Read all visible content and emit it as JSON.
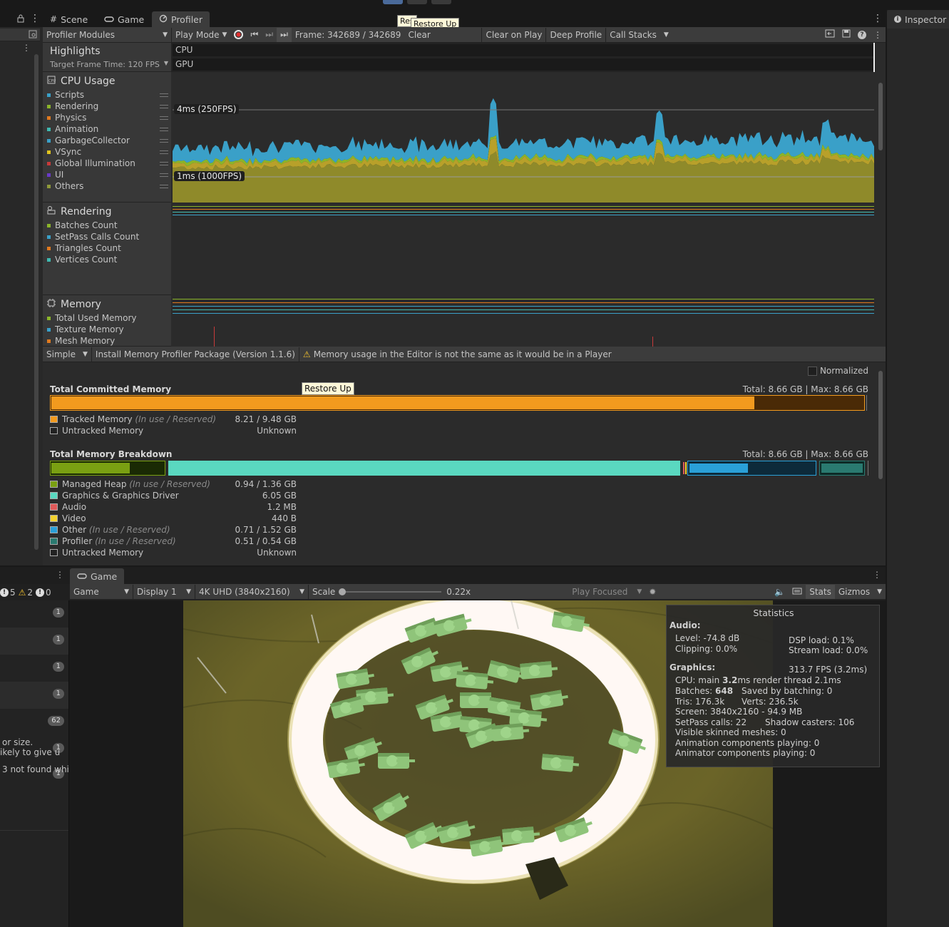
{
  "topbar": {
    "tabs": [
      {
        "label": "Scene"
      },
      {
        "label": "Game"
      },
      {
        "label": "Profiler"
      }
    ],
    "tooltip_partial": "Res",
    "tooltip": "Restore Up",
    "inspector": "Inspector"
  },
  "toolbar": {
    "modules": "Profiler Modules",
    "play_mode": "Play Mode",
    "frame": "Frame: 342689 / 342689",
    "clear": "Clear",
    "clear_on_play": "Clear on Play",
    "deep_profile": "Deep Profile",
    "call_stacks": "Call Stacks"
  },
  "highlights": {
    "title": "Highlights",
    "target": "Target Frame Time: 120 FPS",
    "rows": [
      "CPU",
      "GPU"
    ]
  },
  "cpu_module": {
    "title": "CPU Usage",
    "legend": [
      {
        "label": "Scripts",
        "color": "#3aa0c8"
      },
      {
        "label": "Rendering",
        "color": "#8bb52a"
      },
      {
        "label": "Physics",
        "color": "#e07a1f"
      },
      {
        "label": "Animation",
        "color": "#3fb8b0"
      },
      {
        "label": "GarbageCollector",
        "color": "#3aa0c8"
      },
      {
        "label": "VSync",
        "color": "#e0c41f"
      },
      {
        "label": "Global Illumination",
        "color": "#c83a3a"
      },
      {
        "label": "UI",
        "color": "#6a3ac8"
      },
      {
        "label": "Others",
        "color": "#8f9a3a"
      }
    ],
    "marker_high": "4ms (250FPS)",
    "marker_low": "1ms (1000FPS)"
  },
  "rendering_module": {
    "title": "Rendering",
    "legend": [
      {
        "label": "Batches Count",
        "color": "#8bb52a"
      },
      {
        "label": "SetPass Calls Count",
        "color": "#3aa0c8"
      },
      {
        "label": "Triangles Count",
        "color": "#e07a1f"
      },
      {
        "label": "Vertices Count",
        "color": "#3fb8b0"
      }
    ]
  },
  "memory_module": {
    "title": "Memory",
    "legend": [
      {
        "label": "Total Used Memory",
        "color": "#8bb52a"
      },
      {
        "label": "Texture Memory",
        "color": "#3aa0c8"
      },
      {
        "label": "Mesh Memory",
        "color": "#e07a1f"
      }
    ]
  },
  "memory_toolbar": {
    "mode": "Simple",
    "install": "Install Memory Profiler Package (Version 1.1.6)",
    "warning": "Memory usage in the Editor is not the same as it would be in a Player"
  },
  "memory_detail": {
    "normalized": "Normalized",
    "tooltip": "Restore Up",
    "committed": {
      "title": "Total Committed Memory",
      "total": "Total: 8.66 GB | Max: 8.66 GB",
      "tracked_fraction": 0.866,
      "rows": [
        {
          "label": "Tracked Memory",
          "note": "(In use / Reserved)",
          "value": "8.21 / 9.48 GB",
          "color": "#f29a1e"
        },
        {
          "label": "Untracked Memory",
          "note": "",
          "value": "Unknown",
          "color": "#222222"
        }
      ]
    },
    "breakdown": {
      "title": "Total Memory Breakdown",
      "total": "Total: 8.66 GB | Max: 8.66 GB",
      "rows": [
        {
          "label": "Managed Heap",
          "note": "(In use / Reserved)",
          "value": "0.94 / 1.36 GB",
          "color": "#7aa012"
        },
        {
          "label": "Graphics & Graphics Driver",
          "note": "",
          "value": "6.05 GB",
          "color": "#5ad8c0"
        },
        {
          "label": "Audio",
          "note": "",
          "value": "1.2 MB",
          "color": "#e05a5a"
        },
        {
          "label": "Video",
          "note": "",
          "value": "440 B",
          "color": "#f2d22e"
        },
        {
          "label": "Other",
          "note": "(In use / Reserved)",
          "value": "0.71 / 1.52 GB",
          "color": "#2aa0d8"
        },
        {
          "label": "Profiler",
          "note": "(In use / Reserved)",
          "value": "0.51 / 0.54 GB",
          "color": "#2a7a70"
        },
        {
          "label": "Untracked Memory",
          "note": "",
          "value": "Unknown",
          "color": "#222222"
        }
      ]
    }
  },
  "game": {
    "tab": "Game",
    "counts": {
      "info": "5",
      "warn": "2",
      "error": "0"
    },
    "mode": "Game",
    "display": "Display 1",
    "resolution": "4K UHD (3840x2160)",
    "scale_label": "Scale",
    "scale_value": "0.22x",
    "play_focused": "Play Focused",
    "stats_btn": "Stats",
    "gizmos": "Gizmos"
  },
  "console": {
    "pills": [
      "1",
      "1",
      "1",
      "1",
      "62",
      "1",
      "1"
    ],
    "snippets": [
      "or size.",
      "ikely to give u",
      "3 not found whil"
    ]
  },
  "stats": {
    "title": "Statistics",
    "audio_h": "Audio:",
    "level": "Level: -74.8 dB",
    "clipping": "Clipping: 0.0%",
    "dsp": "DSP load: 0.1%",
    "stream": "Stream load: 0.0%",
    "graphics_h": "Graphics:",
    "fps": "313.7 FPS (3.2ms)",
    "cpu_pre": "CPU: main ",
    "cpu_main": "3.2",
    "cpu_post": "ms  render thread 2.1ms",
    "batches_pre": "Batches: ",
    "batches": "648",
    "saved": "Saved by batching: 0",
    "tris": "Tris: 176.3k",
    "verts": "Verts: 236.5k",
    "screen": "Screen: 3840x2160 - 94.9 MB",
    "setpass": "SetPass calls: 22",
    "shadow": "Shadow casters: 106",
    "skinned": "Visible skinned meshes: 0",
    "anim": "Animation components playing: 0",
    "animator": "Animator components playing: 0"
  }
}
